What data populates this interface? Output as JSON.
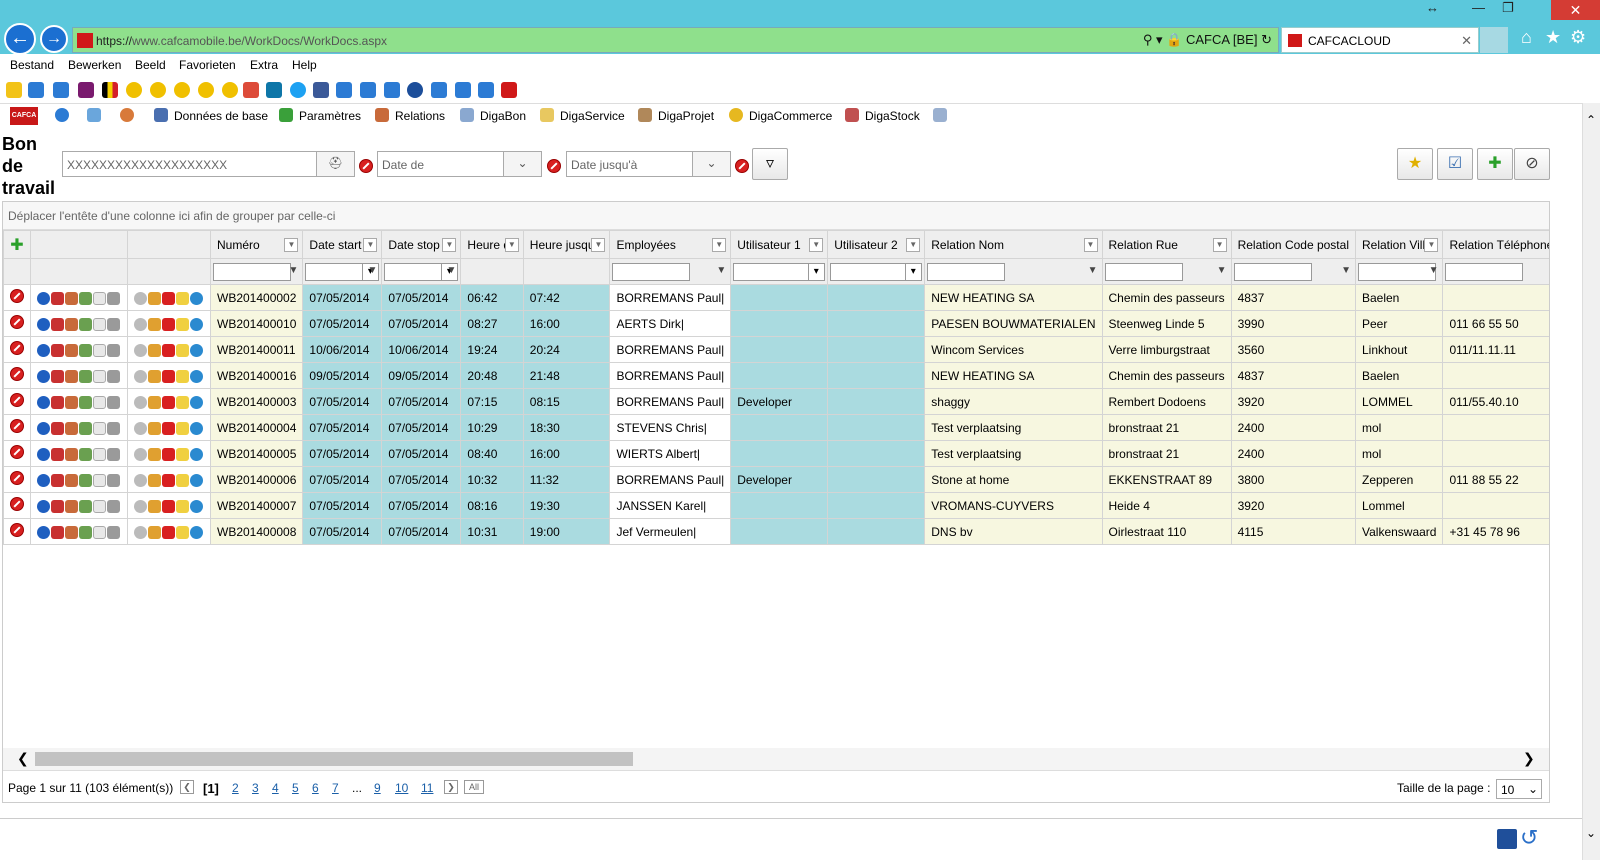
{
  "browser": {
    "url_prefix": "https://",
    "url_host": "www.cafcamobile.be",
    "url_path": "/WorkDocs/WorkDocs.aspx",
    "site_identity": "CAFCA [BE]",
    "tab_title": "CAFCACLOUD"
  },
  "menu": [
    "Bestand",
    "Bewerken",
    "Beeld",
    "Favorieten",
    "Extra",
    "Help"
  ],
  "app_nav": {
    "logo": "CAFCA",
    "items": [
      "Données de base",
      "Paramètres",
      "Relations",
      "DigaBon",
      "DigaService",
      "DigaProjet",
      "DigaCommerce",
      "DigaStock"
    ]
  },
  "page": {
    "title_line1": "Bon",
    "title_line2": "de",
    "title_line3": "travail",
    "search_value": "XXXXXXXXXXXXXXXXXXXX",
    "date_from_placeholder": "Date de",
    "date_to_placeholder": "Date jusqu'à"
  },
  "grid": {
    "group_hint": "Déplacer l'entête d'une colonne ici afin de grouper par celle-ci",
    "columns": [
      "Numéro",
      "Date start",
      "Date stop",
      "Heure du",
      "Heure jusqu'à",
      "Employées",
      "Utilisateur 1",
      "Utilisateur 2",
      "Relation Nom",
      "Relation Rue",
      "Relation Code postal",
      "Relation Ville",
      "Relation Téléphone"
    ],
    "rows": [
      {
        "num": "WB201400002",
        "start": "07/05/2014",
        "stop": "07/05/2014",
        "from": "06:42",
        "to": "07:42",
        "emp": "BORREMANS Paul|",
        "u1": "",
        "u2": "",
        "rel": "NEW HEATING SA",
        "rue": "Chemin des passeurs",
        "cp": "4837",
        "ville": "Baelen",
        "tel": ""
      },
      {
        "num": "WB201400010",
        "start": "07/05/2014",
        "stop": "07/05/2014",
        "from": "08:27",
        "to": "16:00",
        "emp": "AERTS Dirk|",
        "u1": "",
        "u2": "",
        "rel": "PAESEN BOUWMATERIALEN",
        "rue": "Steenweg Linde 5",
        "cp": "3990",
        "ville": "Peer",
        "tel": "011 66 55 50"
      },
      {
        "num": "WB201400011",
        "start": "10/06/2014",
        "stop": "10/06/2014",
        "from": "19:24",
        "to": "20:24",
        "emp": "BORREMANS Paul|",
        "u1": "",
        "u2": "",
        "rel": "Wincom Services",
        "rue": "Verre limburgstraat",
        "cp": "3560",
        "ville": "Linkhout",
        "tel": "011/11.11.11"
      },
      {
        "num": "WB201400016",
        "start": "09/05/2014",
        "stop": "09/05/2014",
        "from": "20:48",
        "to": "21:48",
        "emp": "BORREMANS Paul|",
        "u1": "",
        "u2": "",
        "rel": "NEW HEATING SA",
        "rue": "Chemin des passeurs",
        "cp": "4837",
        "ville": "Baelen",
        "tel": ""
      },
      {
        "num": "WB201400003",
        "start": "07/05/2014",
        "stop": "07/05/2014",
        "from": "07:15",
        "to": "08:15",
        "emp": "BORREMANS Paul|",
        "u1": "Developer",
        "u2": "",
        "rel": "shaggy",
        "rue": "Rembert Dodoens",
        "cp": "3920",
        "ville": "LOMMEL",
        "tel": "011/55.40.10"
      },
      {
        "num": "WB201400004",
        "start": "07/05/2014",
        "stop": "07/05/2014",
        "from": "10:29",
        "to": "18:30",
        "emp": "STEVENS Chris|",
        "u1": "",
        "u2": "",
        "rel": "Test verplaatsing",
        "rue": "bronstraat 21",
        "cp": "2400",
        "ville": "mol",
        "tel": ""
      },
      {
        "num": "WB201400005",
        "start": "07/05/2014",
        "stop": "07/05/2014",
        "from": "08:40",
        "to": "16:00",
        "emp": "WIERTS Albert|",
        "u1": "",
        "u2": "",
        "rel": "Test verplaatsing",
        "rue": "bronstraat 21",
        "cp": "2400",
        "ville": "mol",
        "tel": ""
      },
      {
        "num": "WB201400006",
        "start": "07/05/2014",
        "stop": "07/05/2014",
        "from": "10:32",
        "to": "11:32",
        "emp": "BORREMANS Paul|",
        "u1": "Developer",
        "u2": "",
        "rel": "Stone at home",
        "rue": "EKKENSTRAAT 89",
        "cp": "3800",
        "ville": "Zepperen",
        "tel": "011 88 55 22"
      },
      {
        "num": "WB201400007",
        "start": "07/05/2014",
        "stop": "07/05/2014",
        "from": "08:16",
        "to": "19:30",
        "emp": "JANSSEN Karel|",
        "u1": "",
        "u2": "",
        "rel": "VROMANS-CUYVERS",
        "rue": "Heide 4",
        "cp": "3920",
        "ville": "Lommel",
        "tel": ""
      },
      {
        "num": "WB201400008",
        "start": "07/05/2014",
        "stop": "07/05/2014",
        "from": "10:31",
        "to": "19:00",
        "emp": "Jef Vermeulen|",
        "u1": "",
        "u2": "",
        "rel": "DNS bv",
        "rue": "Oirlestraat 110",
        "cp": "4115",
        "ville": "Valkenswaard",
        "tel": "+31 45 78 96"
      }
    ]
  },
  "pager": {
    "info": "Page 1 sur 11 (103 élément(s))",
    "current": "[1]",
    "pages": [
      "2",
      "3",
      "4",
      "5",
      "6",
      "7",
      "...",
      "9",
      "10",
      "11"
    ],
    "all_label": "All",
    "size_label": "Taille de la page :",
    "size_value": "10"
  }
}
